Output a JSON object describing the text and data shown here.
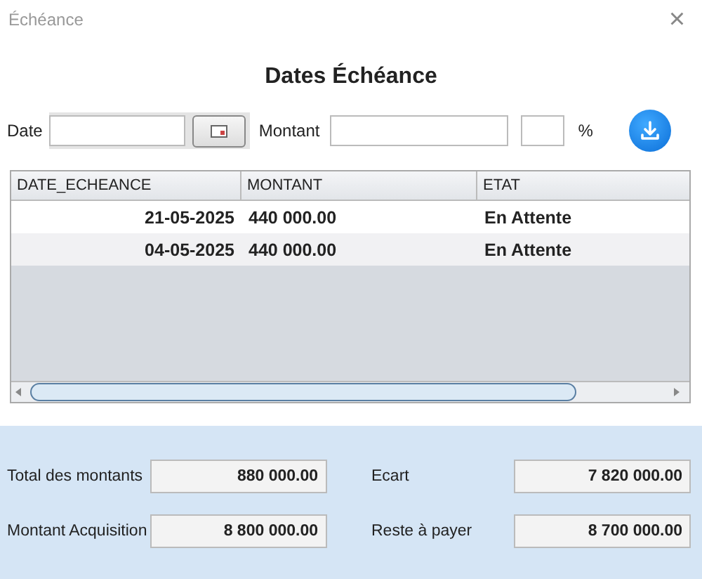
{
  "window": {
    "title": "Échéance",
    "close": "×"
  },
  "heading": "Dates Échéance",
  "form": {
    "date_label": "Date",
    "amount_label": "Montant",
    "percent_label": "%"
  },
  "table": {
    "columns": [
      "DATE_ECHEANCE",
      "MONTANT",
      "ETAT"
    ],
    "rows": [
      {
        "cells": [
          "21-05-2025",
          "440 000.00",
          "En Attente"
        ]
      },
      {
        "cells": [
          "04-05-2025",
          "440 000.00",
          "En Attente"
        ]
      }
    ]
  },
  "summary": [
    {
      "label": "Total des montants",
      "value": "880 000.00"
    },
    {
      "label": "Ecart",
      "value": "7 820 000.00"
    },
    {
      "label": "Montant Acquisition",
      "value": "8 800 000.00"
    },
    {
      "label": "Reste à payer",
      "value": "8 700 000.00"
    }
  ]
}
